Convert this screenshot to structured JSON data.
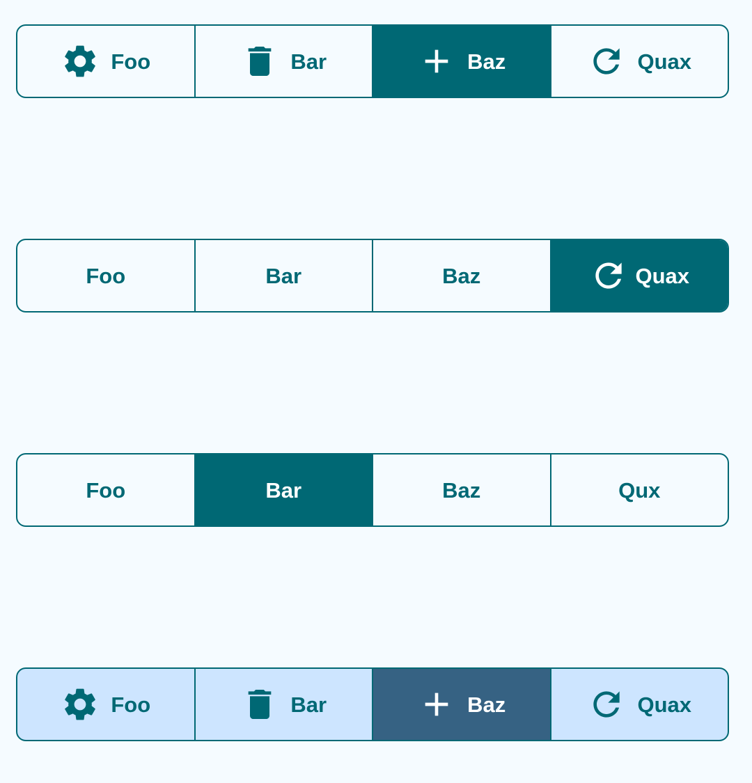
{
  "colors": {
    "background": "#f5fbff",
    "primary": "#006874",
    "on_primary": "#ffffff",
    "tonal_container": "#cde5ff",
    "tonal_selected": "#366283"
  },
  "groups": [
    {
      "buttons": [
        {
          "label": "Foo",
          "icon": "gear-icon",
          "selected": false
        },
        {
          "label": "Bar",
          "icon": "trash-icon",
          "selected": false
        },
        {
          "label": "Baz",
          "icon": "plus-icon",
          "selected": true
        },
        {
          "label": "Quax",
          "icon": "refresh-icon",
          "selected": false
        }
      ]
    },
    {
      "buttons": [
        {
          "label": "Foo",
          "selected": false
        },
        {
          "label": "Bar",
          "selected": false
        },
        {
          "label": "Baz",
          "selected": false
        },
        {
          "label": "Quax",
          "icon": "refresh-icon",
          "selected": true
        }
      ]
    },
    {
      "buttons": [
        {
          "label": "Foo",
          "selected": false
        },
        {
          "label": "Bar",
          "selected": true
        },
        {
          "label": "Baz",
          "selected": false
        },
        {
          "label": "Qux",
          "selected": false
        }
      ]
    },
    {
      "style": "tonal",
      "buttons": [
        {
          "label": "Foo",
          "icon": "gear-icon",
          "selected": false
        },
        {
          "label": "Bar",
          "icon": "trash-icon",
          "selected": false
        },
        {
          "label": "Baz",
          "icon": "plus-icon",
          "selected": true
        },
        {
          "label": "Quax",
          "icon": "refresh-icon",
          "selected": false
        }
      ]
    }
  ]
}
